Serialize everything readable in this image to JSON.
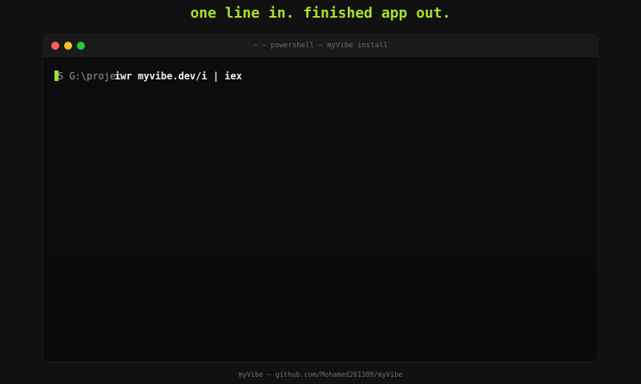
{
  "headline": "one line in. finished app out.",
  "window": {
    "title": "~ — powershell — myVibe install",
    "controls": {
      "close_color": "#ff5f57",
      "minimize_color": "#febc2e",
      "maximize_color": "#28c840"
    }
  },
  "terminal": {
    "prompt": "S G:\\projec",
    "command": "iwr myvibe.dev/i | iex",
    "cursor_color": "#a6e22e"
  },
  "footer": "myVibe — github.com/Mohamed201389/myVibe",
  "colors": {
    "accent": "#a6e22e",
    "background": "#111111"
  }
}
